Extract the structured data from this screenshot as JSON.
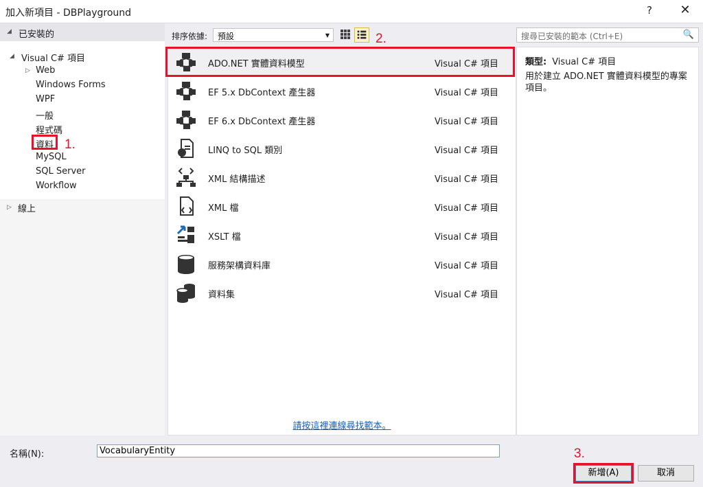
{
  "window": {
    "title": "加入新項目 - DBPlayground",
    "help": "?",
    "close": "✕"
  },
  "tree": {
    "installed": "已安裝的",
    "root": "Visual C# 項目",
    "items": [
      "Web",
      "Windows Forms",
      "WPF",
      "一般",
      "程式碼",
      "資料",
      "MySQL",
      "SQL Server",
      "Workflow"
    ],
    "online": "線上"
  },
  "toolbar": {
    "sort_label": "排序依據:",
    "sort_value": "預設"
  },
  "search": {
    "placeholder": "搜尋已安裝的範本 (Ctrl+E)"
  },
  "templates": [
    {
      "name": "ADO.NET 實體資料模型",
      "type": "Visual C# 項目",
      "icon": "entity-model-icon"
    },
    {
      "name": "EF 5.x DbContext 產生器",
      "type": "Visual C# 項目",
      "icon": "entity-model-icon"
    },
    {
      "name": "EF 6.x DbContext 產生器",
      "type": "Visual C# 項目",
      "icon": "entity-model-icon"
    },
    {
      "name": "LINQ to SQL 類別",
      "type": "Visual C# 項目",
      "icon": "linq-sql-icon"
    },
    {
      "name": "XML 結構描述",
      "type": "Visual C# 項目",
      "icon": "xml-schema-icon"
    },
    {
      "name": "XML 檔",
      "type": "Visual C# 項目",
      "icon": "xml-file-icon"
    },
    {
      "name": "XSLT 檔",
      "type": "Visual C# 項目",
      "icon": "xslt-icon"
    },
    {
      "name": "服務架構資料庫",
      "type": "Visual C# 項目",
      "icon": "database-icon"
    },
    {
      "name": "資料集",
      "type": "Visual C# 項目",
      "icon": "dataset-icon"
    }
  ],
  "online_link": "請按這裡連線尋找範本。",
  "details": {
    "type_label": "類型:",
    "type_value": "Visual C# 項目",
    "description": "用於建立 ADO.NET 實體資料模型的專案項目。"
  },
  "name_field": {
    "label": "名稱(N):",
    "value": "VocabularyEntity"
  },
  "buttons": {
    "add": "新增(A)",
    "cancel": "取消"
  },
  "annotations": [
    "1.",
    "2.",
    "3."
  ],
  "colors": {
    "annotation": "#e8102a",
    "link": "#1a5fb4"
  }
}
